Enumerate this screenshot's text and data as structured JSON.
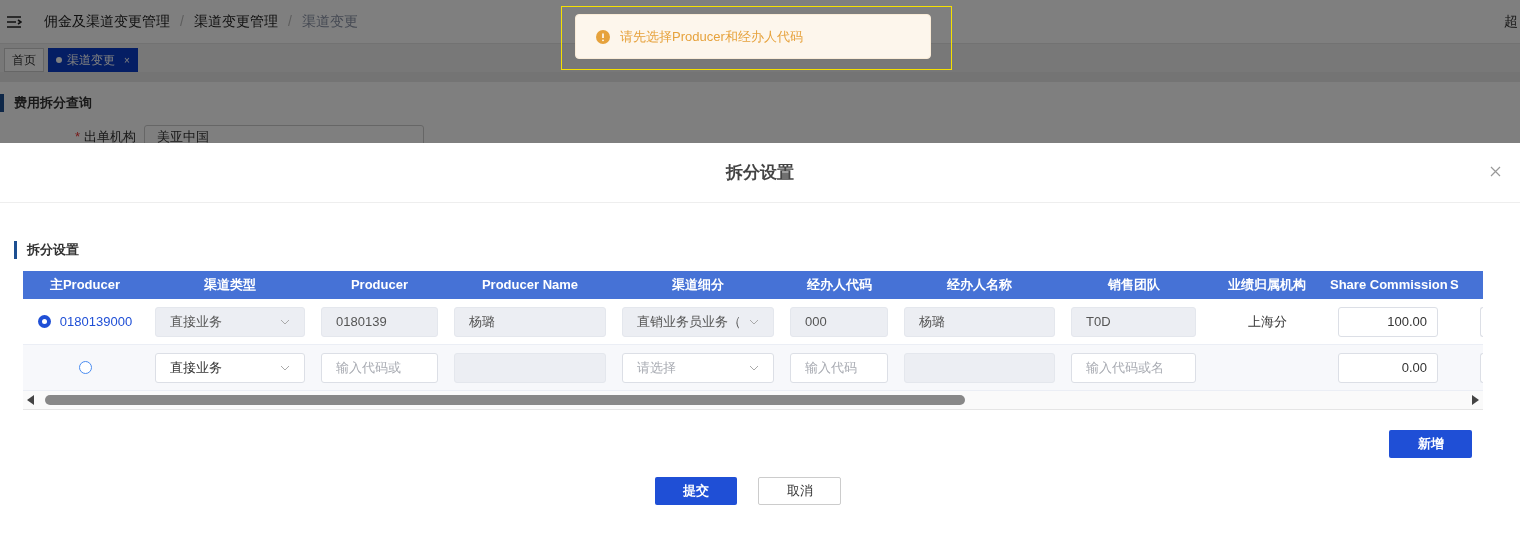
{
  "header": {
    "breadcrumbs": [
      {
        "label": "佣金及渠道变更管理",
        "current": false
      },
      {
        "label": "渠道变更管理",
        "current": false
      },
      {
        "label": "渠道变更",
        "current": true
      }
    ],
    "separator": "/",
    "user": "超"
  },
  "tabs": [
    {
      "label": "首页",
      "selected": false,
      "closable": false
    },
    {
      "label": "渠道变更",
      "selected": true,
      "closable": true
    }
  ],
  "close_glyph": "×",
  "page": {
    "section_title": "费用拆分查询",
    "form": {
      "label": "出单机构",
      "required": true,
      "required_mark": "*",
      "value": "美亚中国"
    }
  },
  "toast": {
    "kind": "warning",
    "message": "请先选择Producer和经办人代码"
  },
  "dialog": {
    "title": "拆分设置",
    "section_title": "拆分设置",
    "table": {
      "columns": [
        "主Producer",
        "渠道类型",
        "Producer",
        "Producer Name",
        "渠道细分",
        "经办人代码",
        "经办人名称",
        "销售团队",
        "业绩归属机构",
        "Share Commission",
        "S"
      ],
      "rows": [
        {
          "selected": true,
          "cells": [
            {
              "kind": "radio",
              "text": "0180139000"
            },
            {
              "kind": "select",
              "value": "直接业务",
              "disabled": true
            },
            {
              "kind": "input",
              "value": "0180139",
              "disabled": true
            },
            {
              "kind": "input",
              "value": "杨璐",
              "disabled": true
            },
            {
              "kind": "select",
              "value": "直销业务员业务（",
              "disabled": true
            },
            {
              "kind": "input",
              "value": "000",
              "disabled": true
            },
            {
              "kind": "input",
              "value": "杨璐",
              "disabled": true
            },
            {
              "kind": "input",
              "value": "T0D",
              "disabled": true
            },
            {
              "kind": "text",
              "text": "上海分"
            },
            {
              "kind": "number",
              "value": "100.00",
              "disabled": false
            }
          ]
        },
        {
          "selected": false,
          "cells": [
            {
              "kind": "radio"
            },
            {
              "kind": "select",
              "value": "直接业务",
              "disabled": false
            },
            {
              "kind": "input",
              "placeholder": "输入代码或",
              "disabled": false
            },
            {
              "kind": "input",
              "disabled": true
            },
            {
              "kind": "select",
              "placeholder": "请选择",
              "disabled": false
            },
            {
              "kind": "input",
              "placeholder": "输入代码",
              "disabled": false
            },
            {
              "kind": "input",
              "disabled": true
            },
            {
              "kind": "input",
              "placeholder": "输入代码或名",
              "disabled": false
            },
            {
              "kind": "text"
            },
            {
              "kind": "number",
              "value": "0.00",
              "disabled": false
            }
          ]
        }
      ]
    },
    "add_button": "新增",
    "submit_button": "提交",
    "cancel_button": "取消"
  }
}
